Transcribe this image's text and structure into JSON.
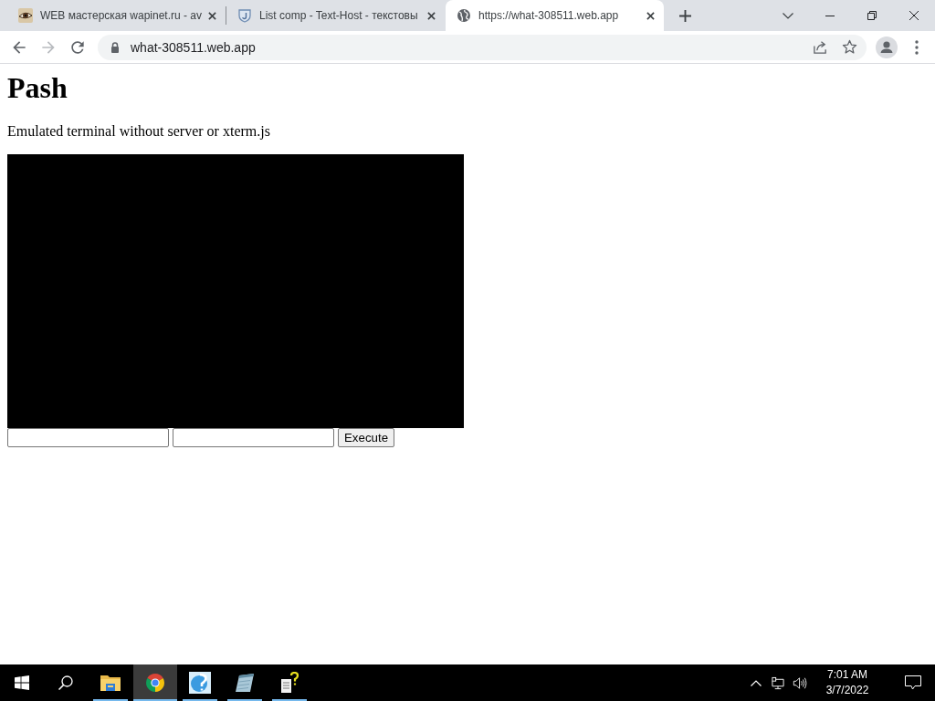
{
  "browser": {
    "tabs": [
      {
        "kind": "eye",
        "title": "WEB мастерская wapinet.ru - av",
        "selected": false
      },
      {
        "kind": "shield",
        "title": "List comp - Text-Host - текстовы",
        "selected": false
      },
      {
        "kind": "globe",
        "title": "https://what-308511.web.app",
        "selected": true
      }
    ],
    "toolbar": {
      "back_disabled": false,
      "forward_disabled": true,
      "url": "what-308511.web.app"
    }
  },
  "page": {
    "heading": "Pash",
    "description": "Emulated terminal without server or xterm.js",
    "fields": [
      {
        "kind": "text"
      },
      {
        "kind": "text"
      }
    ],
    "button": "Execute"
  },
  "taskbar": {
    "apps": [
      {
        "kind": "folder",
        "selected": false,
        "running": true
      },
      {
        "kind": "browser",
        "selected": true,
        "running": true
      },
      {
        "kind": "help",
        "selected": false,
        "running": true
      },
      {
        "kind": "notepad",
        "selected": false,
        "running": true
      },
      {
        "kind": "document",
        "selected": false,
        "running": true
      }
    ],
    "clock": {
      "time": "7:01 AM",
      "date": "3/7/2022"
    }
  }
}
